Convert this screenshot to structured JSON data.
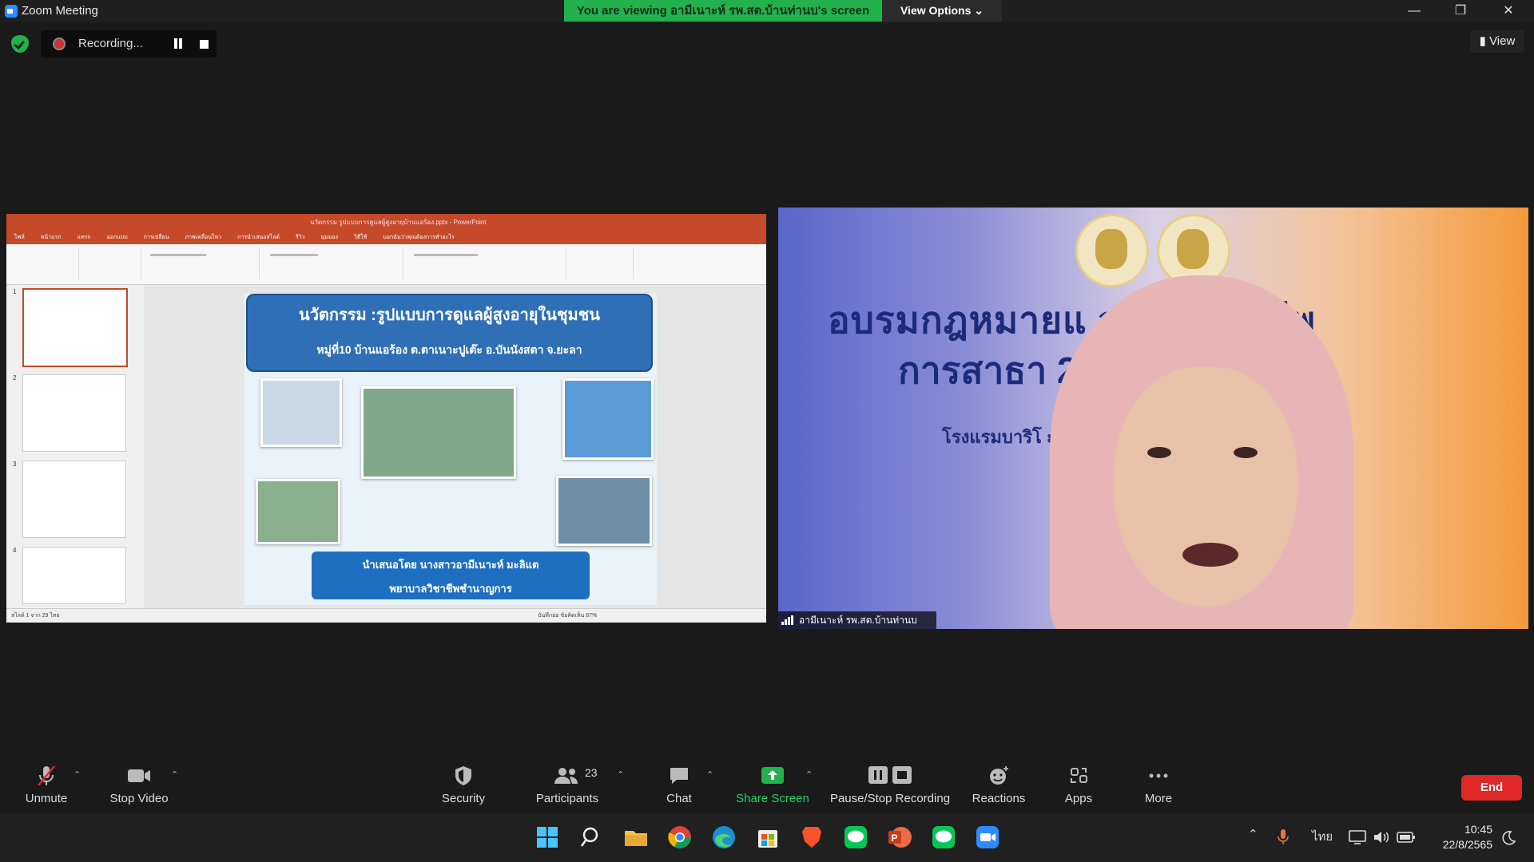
{
  "window": {
    "title": "Zoom Meeting",
    "minimize": "—",
    "restore": "❐",
    "close": "✕"
  },
  "banner": {
    "viewing_text": "You are viewing อามีเนาะห์ รพ.สต.บ้านท่านบ's screen",
    "view_options": "View Options ⌄"
  },
  "recording": {
    "label": "Recording..."
  },
  "view_button": "▮ View",
  "shared_screen": {
    "app": "PowerPoint",
    "file_title": "นวัตกรรม รูปแบบการดูแลผู้สูงอายุบ้านแอร้อง.pptx - PowerPoint",
    "ribbon_tabs": [
      "ไฟล์",
      "หน้าแรก",
      "แทรก",
      "ออกแบบ",
      "การเปลี่ยน",
      "ภาพเคลื่อนไหว",
      "การนำเสนอสไลด์",
      "รีวิว",
      "มุมมอง",
      "วิธีใช้",
      "บอกฉันว่าคุณต้องการทำอะไร"
    ],
    "thumb_numbers": [
      "1",
      "2",
      "3",
      "4"
    ],
    "slide": {
      "title": "นวัตกรรม :รูปแบบการดูแลผู้สูงอายุในชุมชน",
      "subtitle": "หมู่ที่10 บ้านแอร้อง  ต.ตาเนาะปูเต๊ะ อ.บันนังสตา จ.ยะลา",
      "presenter_line1": "นำเสนอโดย นางสาวอามีเนาะห์  มะลิแต",
      "presenter_line2": "พยาบาลวิชาชีพชำนาญการ"
    },
    "status_left": "สไลด์ 1 จาก 29   ไทย",
    "status_right": "บันทึกย่อ   ข้อคิดเห็น   87%"
  },
  "video": {
    "background_line1": "อบรมกฎหมายแ          จรรณวิชาชีพ",
    "background_line2": "การสาธา                  2565",
    "background_line3": "โรงแรมบาริโ                           ะบี่",
    "participant_name": "อามีเนาะห์ รพ.สต.บ้านท่านบ"
  },
  "toolbar": {
    "unmute": "Unmute",
    "stop_video": "Stop Video",
    "security": "Security",
    "participants": "Participants",
    "participants_count": "23",
    "chat": "Chat",
    "share_screen": "Share Screen",
    "pause_stop_recording": "Pause/Stop Recording",
    "reactions": "Reactions",
    "apps": "Apps",
    "more": "More",
    "end": "End"
  },
  "taskbar": {
    "language": "ไทย",
    "time": "10:45",
    "date": "22/8/2565"
  }
}
